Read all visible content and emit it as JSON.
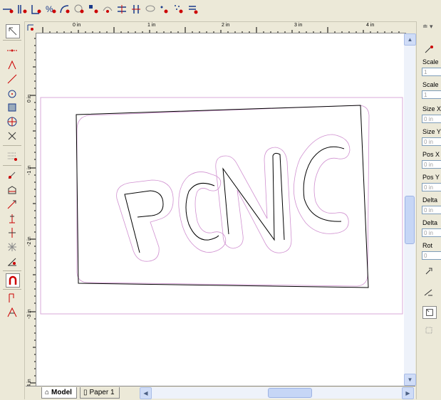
{
  "ruler": {
    "top_labels": [
      "0 in",
      "1 in",
      "2 in",
      "3 in",
      "4 in"
    ],
    "left_labels": [
      "0 in",
      "-1 in",
      "-2 in",
      "-3 in",
      "-4 in"
    ]
  },
  "drawing": {
    "text": "PCNC"
  },
  "tabs": [
    {
      "label": "Model",
      "active": true
    },
    {
      "label": "Paper 1",
      "active": false
    }
  ],
  "properties": {
    "fields": [
      {
        "label": "Scale",
        "value": "1"
      },
      {
        "label": "Scale",
        "value": "1"
      },
      {
        "label": "Size X",
        "value": "0 in"
      },
      {
        "label": "Size Y",
        "value": "0 in"
      },
      {
        "label": "Pos X",
        "value": "0 in"
      },
      {
        "label": "Pos Y",
        "value": "0 in"
      },
      {
        "label": "Delta",
        "value": "0 in"
      },
      {
        "label": "Delta",
        "value": "0 in"
      },
      {
        "label": "Rot",
        "value": "0"
      }
    ]
  },
  "colors": {
    "accent": "#c00000",
    "toolbar": "#ece9d8",
    "scroll": "#cfdcf7",
    "outline": "#d080d0"
  }
}
